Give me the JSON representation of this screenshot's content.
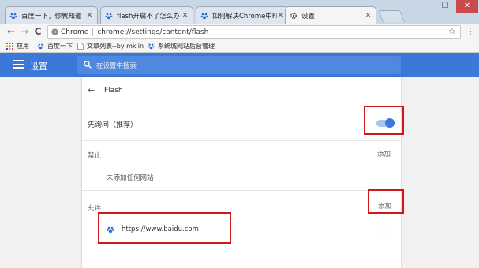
{
  "tabs": [
    {
      "title": "百度一下，你就知道",
      "active": false
    },
    {
      "title": "flash开启不了怎么办 是",
      "active": false
    },
    {
      "title": "如何解决Chrome中Flas",
      "active": false
    },
    {
      "title": "设置",
      "active": true
    }
  ],
  "window": {
    "minimize": "—",
    "maximize": "☐",
    "close": "✕"
  },
  "toolbar": {
    "back": "←",
    "forward": "→",
    "reload": "C",
    "star": "☆",
    "menu": "⋮"
  },
  "omnibox": {
    "chip": "Chrome",
    "url": "chrome://settings/content/flash"
  },
  "bookmarks": [
    {
      "label": "应用"
    },
    {
      "label": "百度一下"
    },
    {
      "label": "文章列表--by mklin"
    },
    {
      "label": "系统城网站后台管理"
    }
  ],
  "header": {
    "title": "设置",
    "search_placeholder": "在设置中搜索"
  },
  "flash": {
    "back": "←",
    "title": "Flash",
    "ask_first_label": "先询问（推荐）",
    "ask_first_on": true,
    "block": {
      "heading": "禁止",
      "add_label": "添加",
      "empty_text": "未添加任何网站"
    },
    "allow": {
      "heading": "允许",
      "add_label": "添加",
      "sites": [
        {
          "url": "https://www.baidu.com",
          "more": "⋮"
        }
      ]
    }
  },
  "colors": {
    "accent": "#3c78d8",
    "highlight": "#d01818"
  }
}
